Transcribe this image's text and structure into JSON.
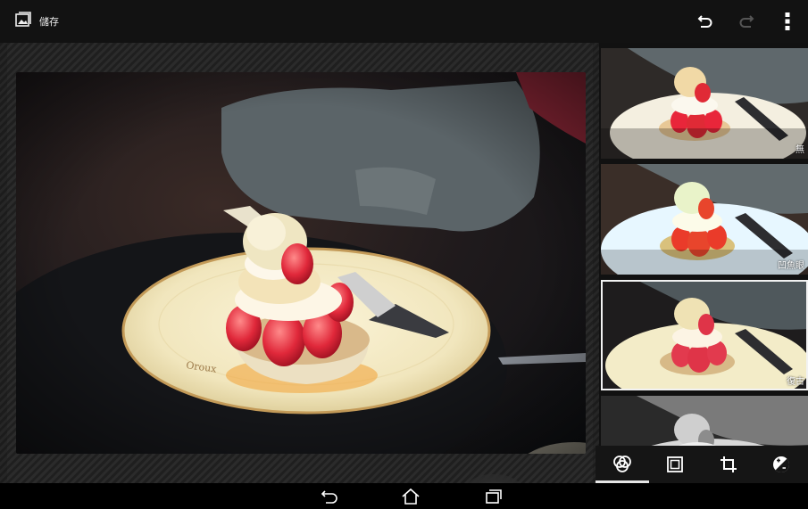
{
  "toolbar_top": {
    "save_label": "儲存",
    "save_icon": "image-save-icon",
    "undo_icon": "undo-icon",
    "redo_icon": "redo-icon",
    "menu_icon": "more-vert-icon"
  },
  "filters": [
    {
      "label": "無",
      "selected": false
    },
    {
      "label": "凹魚眼",
      "selected": false
    },
    {
      "label": "復古",
      "selected": true
    },
    {
      "label": "",
      "selected": false
    }
  ],
  "tools": [
    {
      "icon": "filter-effects-icon",
      "active": true
    },
    {
      "icon": "frame-icon",
      "active": false
    },
    {
      "icon": "crop-icon",
      "active": false
    },
    {
      "icon": "adjust-exposure-icon",
      "active": false
    }
  ],
  "system_nav": {
    "back_icon": "back-icon",
    "home_icon": "home-icon",
    "recents_icon": "recents-icon"
  },
  "colors": {
    "topbar": "#121212",
    "selection": "#f2f2f2",
    "navbar": "#000000"
  }
}
